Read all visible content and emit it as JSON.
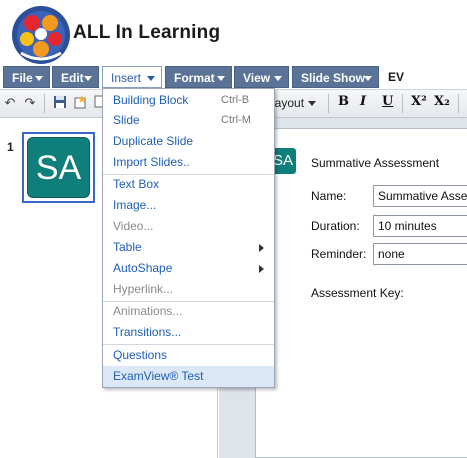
{
  "brand": {
    "name": "ALL In Learning"
  },
  "menubar": {
    "items": [
      {
        "label": "File"
      },
      {
        "label": "Edit"
      },
      {
        "label": "Insert"
      },
      {
        "label": "Format"
      },
      {
        "label": "View"
      },
      {
        "label": "Slide Show"
      }
    ],
    "extra_label": "EV"
  },
  "toolbar": {
    "layout_label": "Layout",
    "bold": "B",
    "italic": "I",
    "underline": "U",
    "superscript": "X²",
    "subscript": "X₂"
  },
  "slides_panel": {
    "slide_number": "1",
    "thumbnail_text": "SA"
  },
  "slide": {
    "icon_text": "SA",
    "title": "Summative Assessment",
    "fields": [
      {
        "label": "Name:",
        "value": "Summative Asse"
      },
      {
        "label": "Duration:",
        "value": "10 minutes"
      },
      {
        "label": "Reminder:",
        "value": "none"
      }
    ],
    "key_label": "Assessment Key:"
  },
  "insert_menu": {
    "items": [
      {
        "label": "Building Block",
        "shortcut": "Ctrl-B"
      },
      {
        "label": "Slide",
        "shortcut": "Ctrl-M"
      },
      {
        "label": "Duplicate Slide"
      },
      {
        "label": "Import Slides.."
      },
      {
        "label": "Text Box"
      },
      {
        "label": "Image..."
      },
      {
        "label": "Video..."
      },
      {
        "label": "Table"
      },
      {
        "label": "AutoShape"
      },
      {
        "label": "Hyperlink..."
      },
      {
        "label": "Animations..."
      },
      {
        "label": "Transitions..."
      },
      {
        "label": "Questions"
      },
      {
        "label": "ExamView® Test"
      }
    ]
  },
  "colors": {
    "menubar_bg": "#5a7397",
    "link_blue": "#1f5fb5",
    "thumbnail_teal": "#0e7f7a",
    "selected_border": "#3a66c4"
  }
}
